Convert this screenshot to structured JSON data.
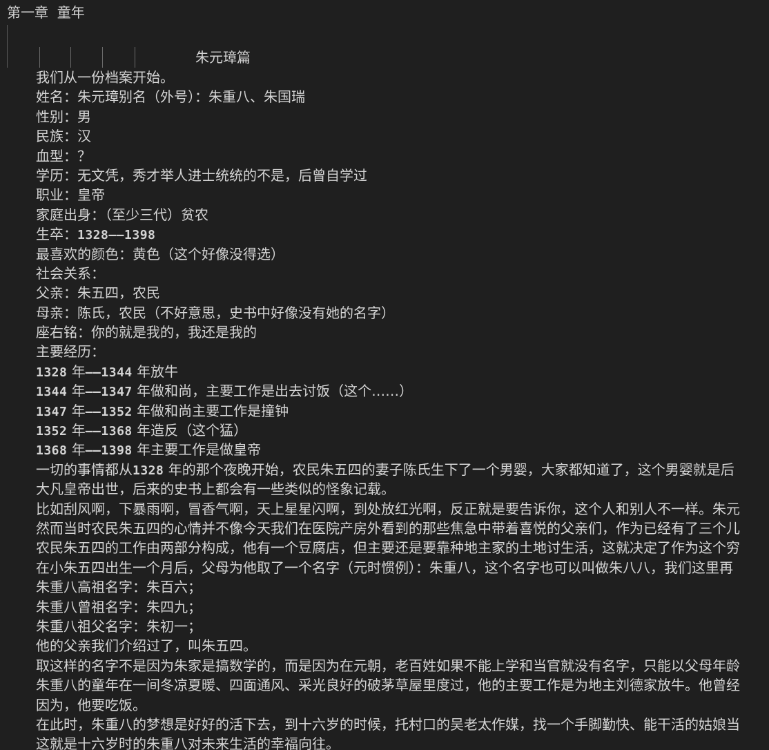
{
  "chapter_title": "第一章  童年",
  "section_heading": "朱元璋篇",
  "lines": [
    {
      "parts": [
        {
          "t": "我们从一份档案开始。"
        }
      ]
    },
    {
      "parts": [
        {
          "t": "姓名：朱元璋别名（外号）：朱重八、朱国瑞"
        }
      ]
    },
    {
      "parts": [
        {
          "t": "性别：男"
        }
      ]
    },
    {
      "parts": [
        {
          "t": "民族：汉"
        }
      ]
    },
    {
      "parts": [
        {
          "t": "血型：？"
        }
      ]
    },
    {
      "parts": [
        {
          "t": "学历：无文凭，秀才举人进士统统的不是，后曾自学过"
        }
      ]
    },
    {
      "parts": [
        {
          "t": "职业：皇帝"
        }
      ]
    },
    {
      "parts": [
        {
          "t": "家庭出身：（至少三代）贫农"
        }
      ]
    },
    {
      "parts": [
        {
          "t": "生卒："
        },
        {
          "t": "1328——1398",
          "num": true
        }
      ]
    },
    {
      "parts": [
        {
          "t": "最喜欢的颜色：黄色（这个好像没得选）"
        }
      ]
    },
    {
      "parts": [
        {
          "t": "社会关系："
        }
      ]
    },
    {
      "parts": [
        {
          "t": "父亲：朱五四，农民"
        }
      ]
    },
    {
      "parts": [
        {
          "t": "母亲：陈氏，农民（不好意思，史书中好像没有她的名字）"
        }
      ]
    },
    {
      "parts": [
        {
          "t": "座右铭：你的就是我的，我还是我的"
        }
      ]
    },
    {
      "parts": [
        {
          "t": "主要经历："
        }
      ]
    },
    {
      "parts": [
        {
          "t": "1328",
          "num": true
        },
        {
          "t": " 年"
        },
        {
          "t": "——1344",
          "num": true
        },
        {
          "t": " 年放牛"
        }
      ]
    },
    {
      "parts": [
        {
          "t": "1344",
          "num": true
        },
        {
          "t": " 年"
        },
        {
          "t": "——1347",
          "num": true
        },
        {
          "t": " 年做和尚，主要工作是出去讨饭（这个……）"
        }
      ]
    },
    {
      "parts": [
        {
          "t": "1347",
          "num": true
        },
        {
          "t": " 年"
        },
        {
          "t": "——1352",
          "num": true
        },
        {
          "t": " 年做和尚主要工作是撞钟"
        }
      ]
    },
    {
      "parts": [
        {
          "t": "1352",
          "num": true
        },
        {
          "t": " 年"
        },
        {
          "t": "——1368",
          "num": true
        },
        {
          "t": " 年造反（这个猛）"
        }
      ]
    },
    {
      "parts": [
        {
          "t": "1368",
          "num": true
        },
        {
          "t": " 年"
        },
        {
          "t": "——1398",
          "num": true
        },
        {
          "t": " 年主要工作是做皇帝"
        }
      ]
    },
    {
      "parts": [
        {
          "t": "一切的事情都从"
        },
        {
          "t": "1328",
          "num": true
        },
        {
          "t": " 年的那个夜晚开始，农民朱五四的妻子陈氏生下了一个男婴，大家都知道了，这个男婴就是后"
        }
      ]
    },
    {
      "parts": [
        {
          "t": "大凡皇帝出世，后来的史书上都会有一些类似的怪象记载。"
        }
      ]
    },
    {
      "parts": [
        {
          "t": "比如刮风啊，下暴雨啊，冒香气啊，天上星星闪啊，到处放红光啊，反正就是要告诉你，这个人和别人不一样。朱元"
        }
      ]
    },
    {
      "parts": [
        {
          "t": "然而当时农民朱五四的心情并不像今天我们在医院产房外看到的那些焦急中带着喜悦的父亲们，作为已经有了三个儿"
        }
      ]
    },
    {
      "parts": [
        {
          "t": "农民朱五四的工作由两部分构成，他有一个豆腐店，但主要还是要靠种地主家的土地讨生活，这就决定了作为这个穷"
        }
      ]
    },
    {
      "parts": [
        {
          "t": "在小朱五四出生一个月后，父母为他取了一个名字（元时惯例）：朱重八，这个名字也可以叫做朱八八，我们这里再"
        }
      ]
    },
    {
      "parts": [
        {
          "t": "朱重八高祖名字：朱百六；"
        }
      ]
    },
    {
      "parts": [
        {
          "t": "朱重八曾祖名字：朱四九；"
        }
      ]
    },
    {
      "parts": [
        {
          "t": "朱重八祖父名字：朱初一；"
        }
      ]
    },
    {
      "parts": [
        {
          "t": "他的父亲我们介绍过了，叫朱五四。"
        }
      ]
    },
    {
      "parts": [
        {
          "t": "取这样的名字不是因为朱家是搞数学的，而是因为在元朝，老百姓如果不能上学和当官就没有名字，只能以父母年龄"
        }
      ]
    },
    {
      "parts": [
        {
          "t": "朱重八的童年在一间冬凉夏暖、四面通风、采光良好的破茅草屋里度过，他的主要工作是为地主刘德家放牛。他曾经"
        }
      ]
    },
    {
      "parts": [
        {
          "t": "因为，他要吃饭。"
        }
      ]
    },
    {
      "parts": [
        {
          "t": "在此时，朱重八的梦想是好好的活下去，到十六岁的时候，托村口的吴老太作媒，找一个手脚勤快、能干活的姑娘当"
        }
      ]
    },
    {
      "parts": [
        {
          "t": "这就是十六岁时的朱重八对未来生活的幸福向往。"
        }
      ]
    }
  ]
}
